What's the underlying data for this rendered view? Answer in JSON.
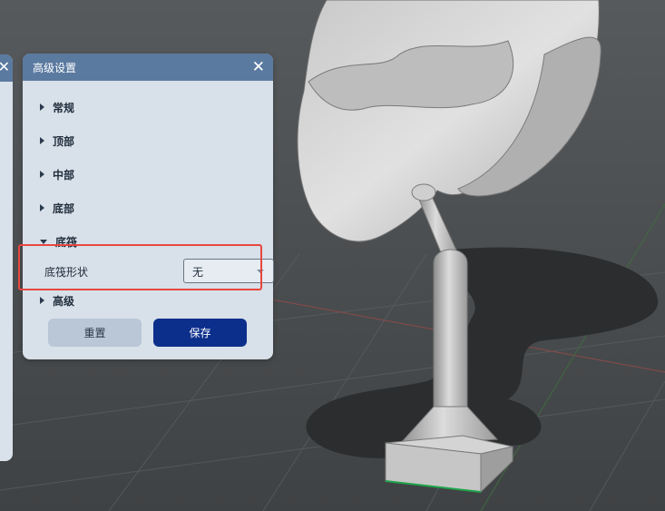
{
  "dialog": {
    "title": "高级设置",
    "close_glyph": "✕",
    "sections": [
      {
        "label": "常规",
        "expanded": false
      },
      {
        "label": "顶部",
        "expanded": false
      },
      {
        "label": "中部",
        "expanded": false
      },
      {
        "label": "底部",
        "expanded": false
      },
      {
        "label": "底筏",
        "expanded": true
      },
      {
        "label": "高级",
        "expanded": false
      }
    ],
    "raft_shape": {
      "label": "底筏形状",
      "value": "无"
    },
    "reset_label": "重置",
    "save_label": "保存"
  },
  "side_panel": {
    "close_glyph": "✕"
  },
  "colors": {
    "header": "#5b7aa0",
    "panel": "#d8e0e9",
    "save_button": "#0d2f8c",
    "reset_button": "#b9c7d6",
    "highlight": "#e8463f",
    "scene_background": "#4b4e50"
  }
}
